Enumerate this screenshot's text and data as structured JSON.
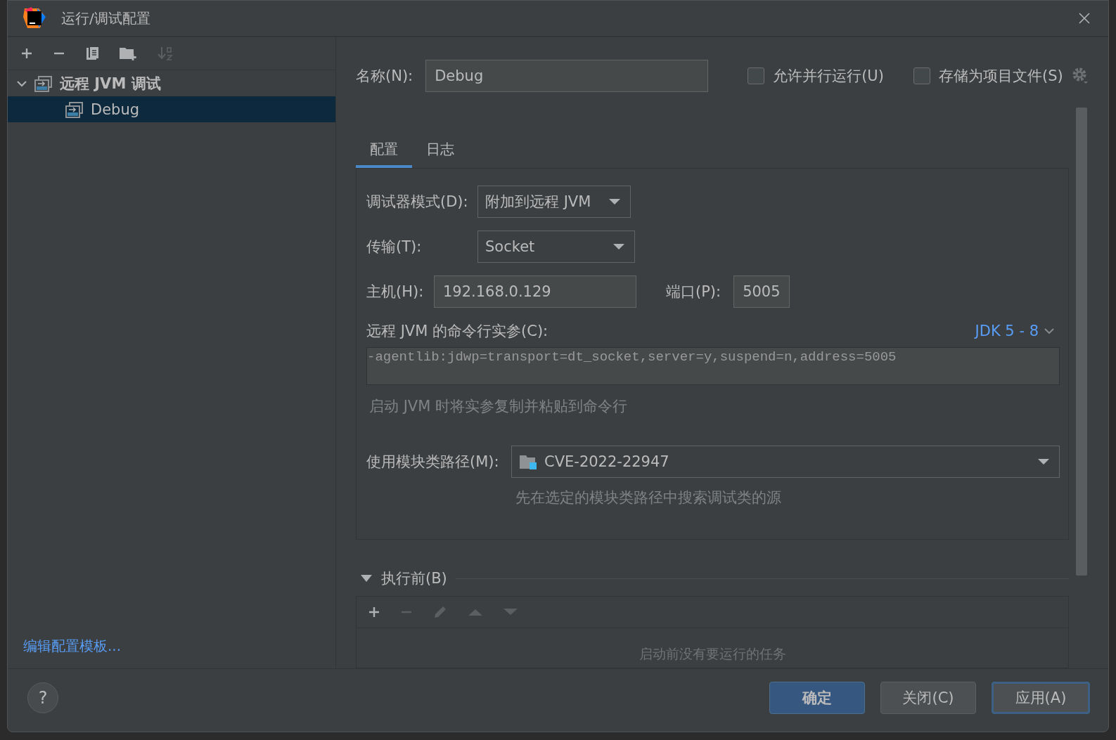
{
  "window": {
    "title": "运行/调试配置"
  },
  "toolbar": [
    {
      "kind": "add",
      "disabled": false
    },
    {
      "kind": "remove",
      "disabled": false
    },
    {
      "kind": "copy",
      "disabled": false
    },
    {
      "kind": "folder",
      "disabled": false
    },
    {
      "kind": "sort",
      "disabled": true
    }
  ],
  "tree": [
    {
      "label": "远程 JVM 调试",
      "expanded": true,
      "selected": false,
      "children": [
        {
          "label": "Debug",
          "selected": true
        }
      ]
    }
  ],
  "edit_templates_link": "编辑配置模板...",
  "help": "?",
  "name_field": {
    "label": "名称(N):",
    "value": "Debug"
  },
  "options": [
    {
      "label": "允许并行运行(U)",
      "checked": false
    },
    {
      "label": "存储为项目文件(S)",
      "checked": false
    }
  ],
  "tabs": [
    {
      "label": "配置",
      "selected": true
    },
    {
      "label": "日志",
      "selected": false
    }
  ],
  "debugger_mode": {
    "label": "调试器模式(D):",
    "value": "附加到远程 JVM"
  },
  "transport": {
    "label": "传输(T):",
    "value": "Socket"
  },
  "host": {
    "label": "主机(H):",
    "value": "192.168.0.129"
  },
  "port": {
    "label": "端口(P):",
    "value": "5005"
  },
  "command_line": {
    "label": "远程 JVM 的命令行实参(C):",
    "jdk": "JDK 5 - 8",
    "value": "-agentlib:jdwp=transport=dt_socket,server=y,suspend=n,address=5005",
    "hint": "启动 JVM 时将实参复制并粘贴到命令行"
  },
  "module": {
    "label": "使用模块类路径(M):",
    "value": "CVE-2022-22947",
    "hint": "先在选定的模块类路径中搜索调试类的源"
  },
  "before_launch": {
    "title": "执行前(B)",
    "expanded": true,
    "tools": [
      {
        "kind": "add",
        "disabled": false
      },
      {
        "kind": "remove",
        "disabled": true
      },
      {
        "kind": "edit",
        "disabled": true
      },
      {
        "kind": "up",
        "disabled": true
      },
      {
        "kind": "down",
        "disabled": true
      }
    ],
    "empty_text": "启动前没有要运行的任务"
  },
  "buttons": [
    {
      "label": "确定",
      "kind": "primary"
    },
    {
      "label": "关闭(C)",
      "kind": "normal"
    },
    {
      "label": "应用(A)",
      "kind": "focused"
    }
  ]
}
